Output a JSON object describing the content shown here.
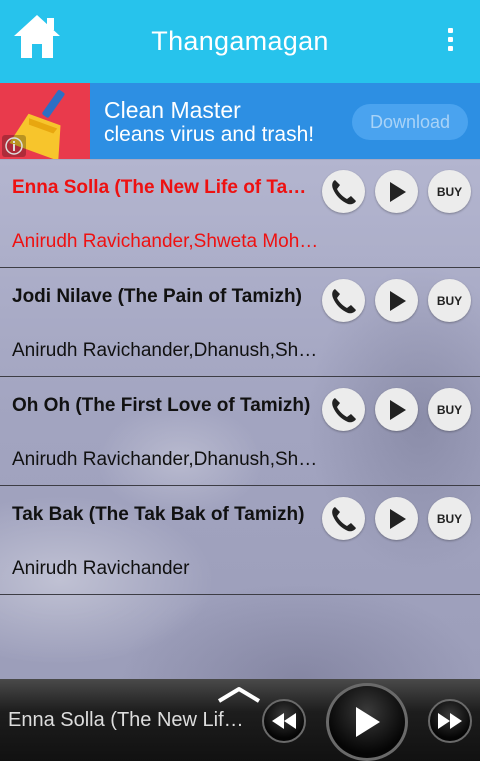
{
  "header": {
    "title": "Thangamagan",
    "home_icon": "home-icon",
    "menu_icon": "overflow-menu-icon",
    "color": "#27c3ec"
  },
  "ad": {
    "title": "Clean Master",
    "subtitle": "cleans virus and trash!",
    "button_label": "Download",
    "icon": "broom-icon",
    "info_icon": "info-icon",
    "colors": {
      "background": "#2d8fe3",
      "icon_box": "#e93a4c"
    }
  },
  "songs": [
    {
      "title": "Enna Solla (The New Life of Tamizh)",
      "artist": "Anirudh Ravichander,Shweta Mohan",
      "active": true,
      "buy_label": "BUY"
    },
    {
      "title": "Jodi Nilave (The Pain of Tamizh)",
      "artist": "Anirudh Ravichander,Dhanush,Shweta Mohan",
      "active": false,
      "buy_label": "BUY"
    },
    {
      "title": "Oh Oh (The First Love of Tamizh)",
      "artist": "Anirudh Ravichander,Dhanush,Shweta Mohan",
      "active": false,
      "buy_label": "BUY"
    },
    {
      "title": "Tak Bak (The Tak Bak of Tamizh)",
      "artist": "Anirudh Ravichander",
      "active": false,
      "buy_label": "BUY"
    }
  ],
  "player": {
    "now_playing": "Enna Solla (The New Life of Tamizh)",
    "icons": [
      "chevron-up-icon",
      "rewind-icon",
      "play-icon",
      "fast-forward-icon"
    ]
  },
  "colors": {
    "active_song": "#ee1111"
  }
}
